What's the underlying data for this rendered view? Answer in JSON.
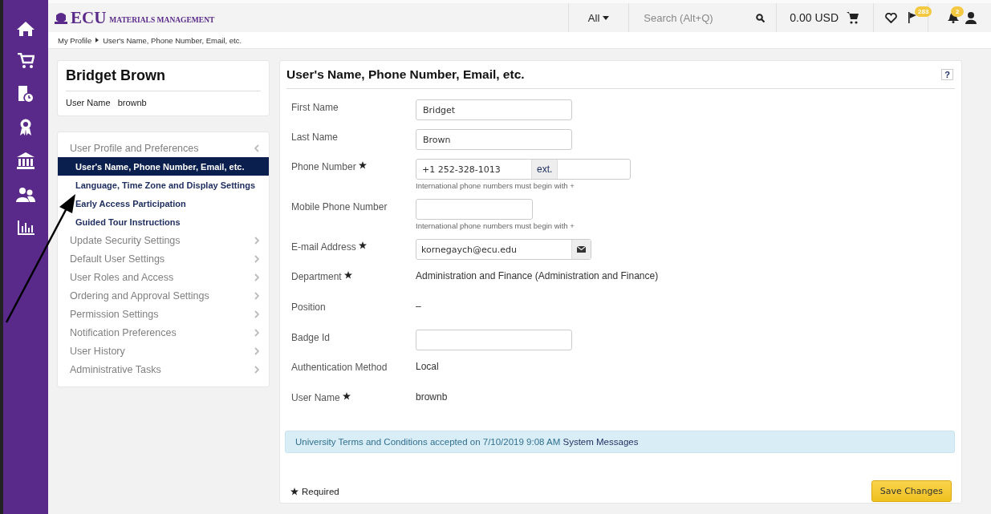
{
  "header": {
    "logo_mark": "ECU",
    "logo_text": "MATERIALS MANAGEMENT",
    "search_scope": "All",
    "search_placeholder": "Search (Alt+Q)",
    "cart_total": "0.00 USD",
    "flag_badge": "283",
    "bell_badge": "2"
  },
  "breadcrumb": [
    "My Profile",
    "User's Name, Phone Number, Email, etc."
  ],
  "profile": {
    "name": "Bridget Brown",
    "user_name_label": "User Name",
    "user_name": "brownb"
  },
  "menu": [
    {
      "label": "User Profile and Preferences",
      "expanded": true,
      "children": [
        {
          "label": "User's Name, Phone Number, Email, etc.",
          "selected": true
        },
        {
          "label": "Language, Time Zone and Display Settings",
          "selected": false
        },
        {
          "label": "Early Access Participation",
          "selected": false
        },
        {
          "label": "Guided Tour Instructions",
          "selected": false
        }
      ]
    },
    {
      "label": "Update Security Settings",
      "expanded": false
    },
    {
      "label": "Default User Settings",
      "expanded": false
    },
    {
      "label": "User Roles and Access",
      "expanded": false
    },
    {
      "label": "Ordering and Approval Settings",
      "expanded": false
    },
    {
      "label": "Permission Settings",
      "expanded": false
    },
    {
      "label": "Notification Preferences",
      "expanded": false
    },
    {
      "label": "User History",
      "expanded": false
    },
    {
      "label": "Administrative Tasks",
      "expanded": false
    }
  ],
  "form": {
    "title": "User's Name, Phone Number, Email, etc.",
    "help": "?",
    "fields": [
      {
        "kind": "input",
        "label": "First Name",
        "required": false,
        "value": "Bridget"
      },
      {
        "kind": "input",
        "label": "Last Name",
        "required": false,
        "value": "Brown"
      },
      {
        "kind": "phone",
        "label": "Phone Number",
        "required": true,
        "value": "+1 252-328-1013",
        "ext_label": "ext.",
        "hint": "International phone numbers must begin with +"
      },
      {
        "kind": "short",
        "label": "Mobile Phone Number",
        "required": false,
        "hint": "International phone numbers must begin with +"
      },
      {
        "kind": "email",
        "label": "E-mail Address",
        "required": true,
        "value": "kornegaych@ecu.edu"
      },
      {
        "kind": "static",
        "label": "Department",
        "required": true,
        "value": "Administration and Finance (Administration and Finance)"
      },
      {
        "kind": "static",
        "label": "Position",
        "required": false,
        "value": "–"
      },
      {
        "kind": "input",
        "label": "Badge Id",
        "required": false
      },
      {
        "kind": "static",
        "label": "Authentication Method",
        "required": false,
        "value": "Local"
      },
      {
        "kind": "static",
        "label": "User Name",
        "required": true,
        "value": "brownb"
      }
    ],
    "notice": {
      "text": "University Terms and Conditions accepted on 7/10/2019 9:08 AM",
      "link": "System Messages"
    },
    "required_legend": "Required",
    "save_button": "Save Changes"
  }
}
